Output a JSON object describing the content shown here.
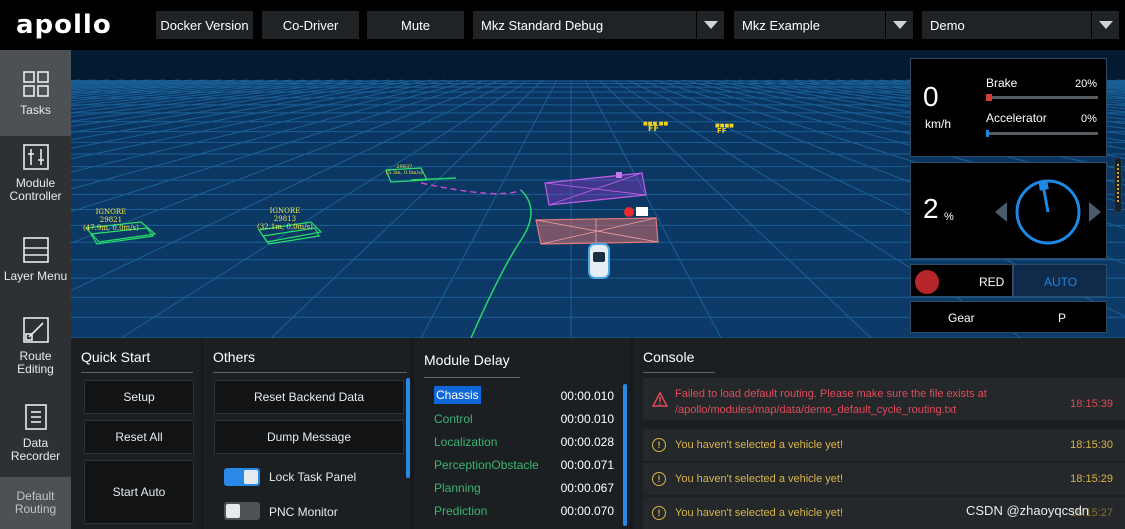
{
  "header": {
    "logo": "apollo",
    "buttons": [
      "Docker Version",
      "Co-Driver",
      "Mute"
    ],
    "selects": [
      {
        "value": "Mkz Standard Debug"
      },
      {
        "value": "Mkz Example"
      },
      {
        "value": "Demo"
      }
    ]
  },
  "sidebar": {
    "items": [
      {
        "label": "Tasks",
        "icon": "grid-icon"
      },
      {
        "label": "Module Controller",
        "icon": "switches-icon"
      },
      {
        "label": "Layer Menu",
        "icon": "layers-icon"
      },
      {
        "label": "Route Editing",
        "icon": "route-icon"
      },
      {
        "label": "Data Recorder",
        "icon": "document-icon"
      }
    ],
    "default_routing": "Default Routing"
  },
  "scene": {
    "obstacles": [
      {
        "tag": "IGNORE",
        "id": "29821",
        "dist": "(47.9m, 0.0m/s)"
      },
      {
        "tag": "IGNORE",
        "id": "29813",
        "dist": "(32.1m, 0.0m/s)"
      },
      {
        "tag": "",
        "id": "29837",
        "dist": "(5.3m, 0.0m/s)"
      }
    ]
  },
  "status": {
    "speed": "0",
    "speed_unit": "km/h",
    "brake_label": "Brake",
    "brake_value": "20%",
    "brake_fraction": 0.05,
    "accel_label": "Accelerator",
    "accel_value": "0%",
    "accel_fraction": 0.03,
    "steer_value": "2",
    "steer_unit": "%",
    "signal_label": "RED",
    "mode_label": "AUTO",
    "gear_label": "Gear",
    "gear_value": "P",
    "colors": {
      "signal": "#b7262b",
      "accent": "#1e88e5",
      "brake": "#d43a3a"
    }
  },
  "quick_start": {
    "title": "Quick Start",
    "buttons": [
      "Setup",
      "Reset All",
      "Start Auto"
    ]
  },
  "others": {
    "title": "Others",
    "buttons": [
      "Reset Backend Data",
      "Dump Message"
    ],
    "toggles": [
      {
        "label": "Lock Task Panel",
        "on": true
      },
      {
        "label": "PNC Monitor",
        "on": false
      }
    ]
  },
  "module_delay": {
    "title": "Module Delay",
    "rows": [
      {
        "name": "Chassis",
        "value": "00:00.010",
        "highlight": true
      },
      {
        "name": "Control",
        "value": "00:00.010"
      },
      {
        "name": "Localization",
        "value": "00:00.028"
      },
      {
        "name": "PerceptionObstacle",
        "value": "00:00.071"
      },
      {
        "name": "Planning",
        "value": "00:00.067"
      },
      {
        "name": "Prediction",
        "value": "00:00.070"
      }
    ]
  },
  "console": {
    "title": "Console",
    "entries": [
      {
        "level": "error",
        "msg1": "Failed to load default routing. Please make sure the file exists at",
        "msg2": "/apollo/modules/map/data/demo_default_cycle_routing.txt",
        "time": "18:15:39"
      },
      {
        "level": "warn",
        "msg1": "You haven't selected a vehicle yet!",
        "time": "18:15:30"
      },
      {
        "level": "warn",
        "msg1": "You haven't selected a vehicle yet!",
        "time": "18:15:29"
      },
      {
        "level": "warn",
        "msg1": "You haven't selected a vehicle yet!",
        "time": "18:15:27"
      }
    ]
  },
  "watermark": "CSDN @zhaoyqcsdn"
}
